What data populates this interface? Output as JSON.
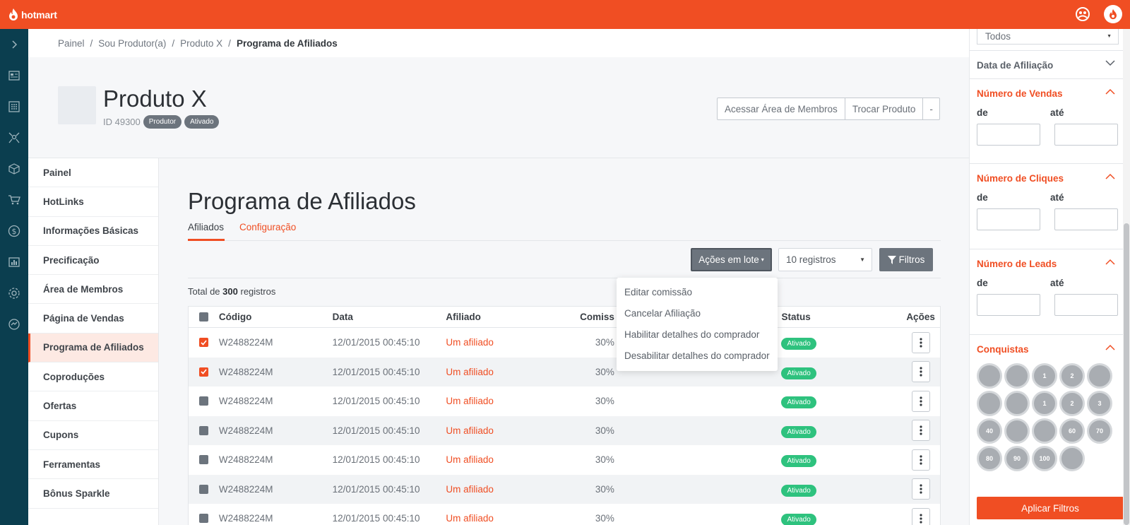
{
  "brand": {
    "name": "hotmart"
  },
  "colors": {
    "accent": "#f04e23",
    "rail": "#0b3e4f",
    "success": "#2ec27e",
    "neutral": "#6c747d"
  },
  "rail_icons": [
    "chevron-right-icon",
    "dashboard-icon",
    "grid-icon",
    "network-icon",
    "box-icon",
    "cart-icon",
    "dollar-icon",
    "chart-icon",
    "gear-icon",
    "refresh-icon"
  ],
  "breadcrumb": [
    {
      "label": "Painel"
    },
    {
      "label": "Sou Produtor(a)"
    },
    {
      "label": "Produto X"
    },
    {
      "label": "Programa de Afiliados"
    }
  ],
  "breadcrumb_sep": "/",
  "product": {
    "title": "Produto X",
    "id_text": "ID 49300",
    "tag_role": "Produtor",
    "tag_status": "Ativado",
    "btn_members": "Acessar Área de Membros",
    "btn_switch": "Trocar Produto",
    "btn_more": "-"
  },
  "menu": [
    {
      "label": "Painel"
    },
    {
      "label": "HotLinks"
    },
    {
      "label": "Informações Básicas"
    },
    {
      "label": "Precificação"
    },
    {
      "label": "Área de Membros"
    },
    {
      "label": "Página de Vendas"
    },
    {
      "label": "Programa de Afiliados"
    },
    {
      "label": "Coproduções"
    },
    {
      "label": "Ofertas"
    },
    {
      "label": "Cupons"
    },
    {
      "label": "Ferramentas"
    },
    {
      "label": "Bônus Sparkle"
    }
  ],
  "page": {
    "title": "Programa de Afiliados",
    "tab_affiliates": "Afiliados",
    "tab_config": "Configuração",
    "batch_label": "Ações em lote",
    "records_select": "10 registros",
    "filter_label": "Filtros",
    "total_prefix": "Total de",
    "total_count": "300",
    "total_suffix": "registros"
  },
  "table": {
    "headers": {
      "code": "Código",
      "date": "Data",
      "affiliate": "Afiliado",
      "commission": "Comiss",
      "status": "Status",
      "actions": "Ações"
    },
    "rows": [
      {
        "code": "W2488224M",
        "date": "12/01/2015 00:45:10",
        "affiliate": "Um afiliado",
        "commission": "30%",
        "status": "Ativado",
        "checked": true
      },
      {
        "code": "W2488224M",
        "date": "12/01/2015 00:45:10",
        "affiliate": "Um afiliado",
        "commission": "30%",
        "status": "Ativado",
        "checked": true
      },
      {
        "code": "W2488224M",
        "date": "12/01/2015 00:45:10",
        "affiliate": "Um afiliado",
        "commission": "30%",
        "status": "Ativado",
        "checked": false
      },
      {
        "code": "W2488224M",
        "date": "12/01/2015 00:45:10",
        "affiliate": "Um afiliado",
        "commission": "30%",
        "status": "Ativado",
        "checked": false
      },
      {
        "code": "W2488224M",
        "date": "12/01/2015 00:45:10",
        "affiliate": "Um afiliado",
        "commission": "30%",
        "status": "Ativado",
        "checked": false
      },
      {
        "code": "W2488224M",
        "date": "12/01/2015 00:45:10",
        "affiliate": "Um afiliado",
        "commission": "30%",
        "status": "Ativado",
        "checked": false
      },
      {
        "code": "W2488224M",
        "date": "12/01/2015 00:45:10",
        "affiliate": "Um afiliado",
        "commission": "30%",
        "status": "Ativado",
        "checked": false
      }
    ]
  },
  "dropdown": [
    {
      "label": "Editar comissão"
    },
    {
      "label": "Cancelar Afiliação"
    },
    {
      "label": "Habilitar detalhes do comprador"
    },
    {
      "label": "Desabilitar detalhes do comprador"
    }
  ],
  "filters": {
    "status_select": "Todos",
    "affiliation_date": "Data de Afiliação",
    "sales": "Número de Vendas",
    "clicks": "Número de Cliques",
    "leads": "Número de Leads",
    "achievements": "Conquistas",
    "from_label": "de",
    "to_label": "até",
    "apply": "Aplicar Filtros",
    "medals": [
      "",
      "",
      "1",
      "2",
      "",
      "",
      "",
      "1",
      "2",
      "3",
      "40",
      "",
      "",
      "60",
      "70",
      "80",
      "90",
      "100",
      ""
    ]
  }
}
